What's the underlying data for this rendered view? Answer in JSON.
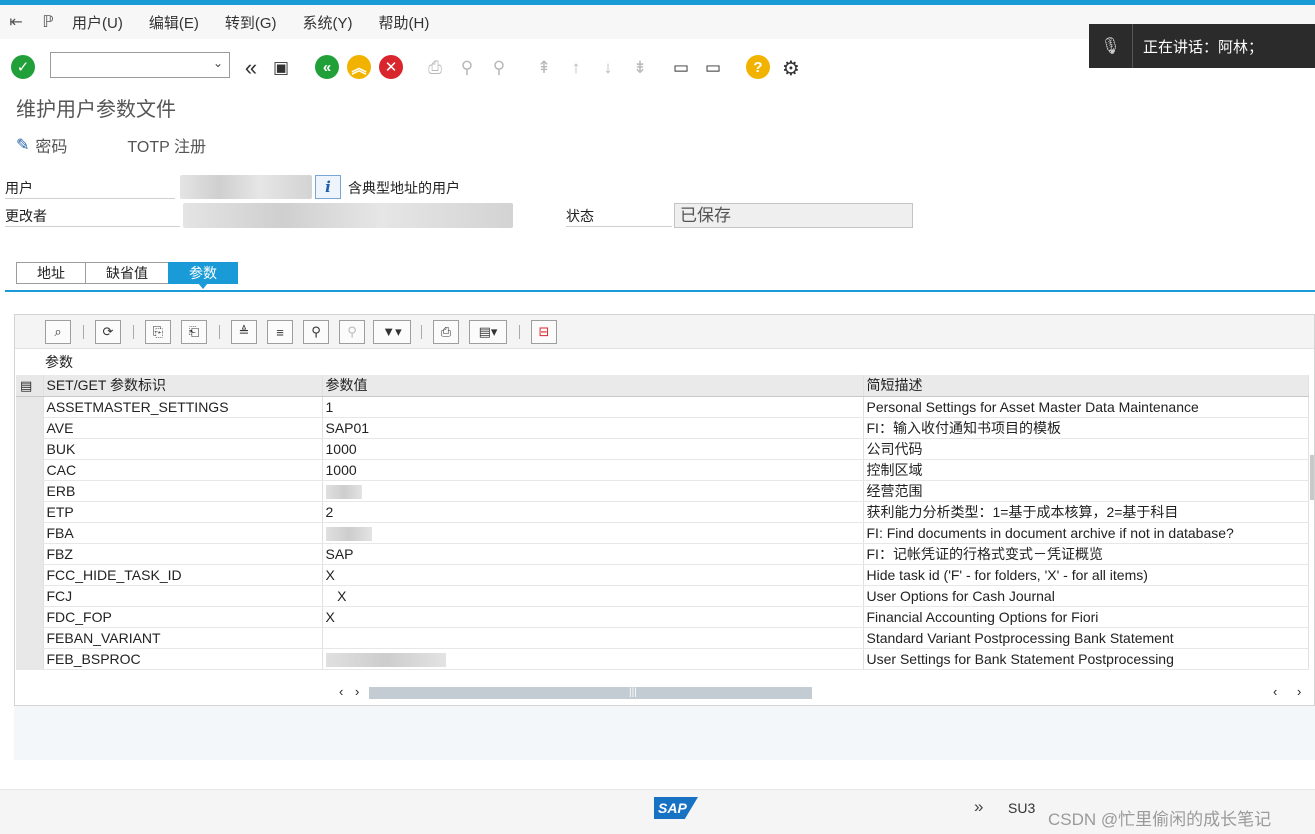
{
  "menu": {
    "items": [
      "用户(U)",
      "编辑(E)",
      "转到(G)",
      "系统(Y)",
      "帮助(H)"
    ]
  },
  "notification": {
    "text": "正在讲话：阿林；"
  },
  "page": {
    "title": "维护用户参数文件"
  },
  "subtoolbar": {
    "password_label": "密码",
    "totp_label": "TOTP 注册"
  },
  "header": {
    "user_label": "用户",
    "typical_address_text": "含典型地址的用户",
    "changed_by_label": "更改者",
    "status_label": "状态",
    "status_value": "已保存"
  },
  "tabs": [
    {
      "label": "地址",
      "active": false
    },
    {
      "label": "缺省值",
      "active": false
    },
    {
      "label": "参数",
      "active": true
    }
  ],
  "grid": {
    "title": "参数",
    "columns": [
      "SET/GET 参数标识",
      "参数值",
      "简短描述"
    ],
    "rows": [
      {
        "id": "ASSETMASTER_SETTINGS",
        "value": "1",
        "desc": "Personal Settings for Asset Master Data Maintenance"
      },
      {
        "id": "AVE",
        "value": "SAP01",
        "desc": "FI：输入收付通知书项目的模板"
      },
      {
        "id": "BUK",
        "value": "1000",
        "desc": "公司代码"
      },
      {
        "id": "CAC",
        "value": "1000",
        "desc": "控制区域"
      },
      {
        "id": "ERB",
        "value": "",
        "desc": "经营范围"
      },
      {
        "id": "ETP",
        "value": "2",
        "desc": "获利能力分析类型：1=基于成本核算，2=基于科目"
      },
      {
        "id": "FBA",
        "value": "",
        "desc": "FI: Find documents in document archive if not in database?"
      },
      {
        "id": "FBZ",
        "value": "SAP",
        "desc": "FI：记帐凭证的行格式变式－凭证概览"
      },
      {
        "id": "FCC_HIDE_TASK_ID",
        "value": "X",
        "desc": "Hide task id ('F' -  for folders, 'X' - for all items)"
      },
      {
        "id": "FCJ",
        "value": "   X",
        "desc": "User Options for Cash Journal"
      },
      {
        "id": "FDC_FOP",
        "value": "X",
        "desc": "Financial Accounting Options for Fiori"
      },
      {
        "id": "FEBAN_VARIANT",
        "value": "",
        "desc": "Standard Variant Postprocessing Bank Statement"
      },
      {
        "id": "FEB_BSPROC",
        "value": "",
        "desc": "User Settings for Bank Statement Postprocessing"
      }
    ]
  },
  "statusbar": {
    "transaction": "SU3",
    "watermark": "CSDN @忙里偷闲的成长笔记"
  },
  "colors": {
    "accent": "#1a9bd7",
    "ok": "#21a03a",
    "warn": "#f2b300",
    "cancel": "#d9262c"
  }
}
